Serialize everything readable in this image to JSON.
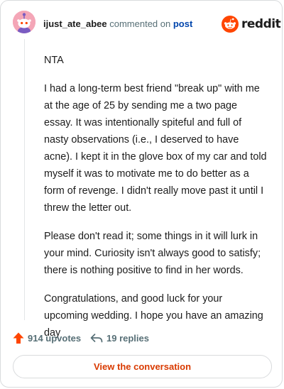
{
  "header": {
    "username": "ijust_ate_abee",
    "action": "commented on",
    "post_link": "post",
    "brand": "reddit"
  },
  "comment": {
    "paragraphs": [
      "NTA",
      "I had a long-term best friend \"break up\" with me at the age of 25 by sending me a two page essay. It was intentionally spiteful and full of nasty observations (i.e., I deserved to have acne). I kept it in the glove box of my car and told myself it was to motivate me to do better as a form of revenge. I didn't really move past it until I threw the letter out.",
      "Please don't read it; some things in it will lurk in your mind. Curiosity isn't always good to satisfy; there is nothing positive to find in her words.",
      "Congratulations, and good luck for your upcoming wedding. I hope you have an amazing day"
    ]
  },
  "footer": {
    "upvotes": "914 upvotes",
    "replies": "19 replies",
    "button_label": "View the conversation"
  },
  "icons": {
    "avatar": "snoo-avatar",
    "brand": "reddit-logo-icon",
    "upvote": "upvote-arrow-icon",
    "reply": "reply-arrow-icon"
  },
  "colors": {
    "accent": "#d93a00",
    "upvote": "#ff4500",
    "link": "#0045ac",
    "muted": "#576f76",
    "avatar_bg": "#f4a6b7"
  }
}
